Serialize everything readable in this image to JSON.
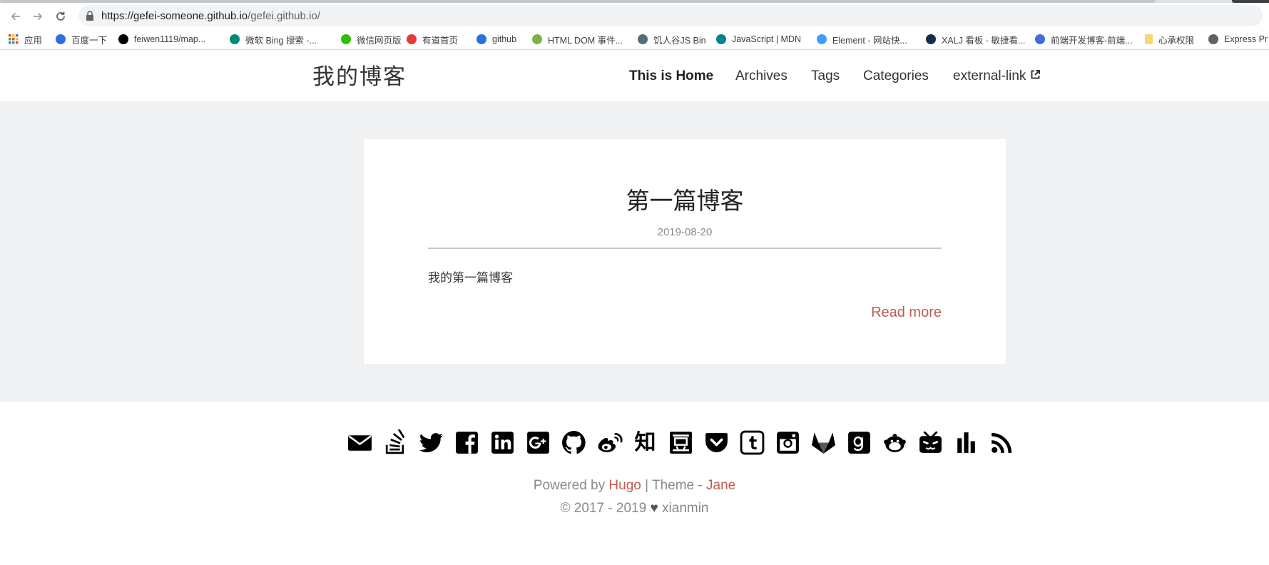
{
  "browser": {
    "url_host": "https://gefei-someone.github.io",
    "url_path": "/gefei.github.io/",
    "bookmarks": [
      {
        "label": "应用",
        "icon": "apps-grid-icon",
        "color": "#e8453c"
      },
      {
        "label": "百度一下",
        "icon": "baidu-paw-icon",
        "color": "#2d6fe0"
      },
      {
        "label": "feiwen1119/map...",
        "icon": "github-icon",
        "color": "#000000"
      },
      {
        "label": "微软 Bing 搜索 -...",
        "icon": "bing-icon",
        "color": "#00897b"
      },
      {
        "label": "微信网页版",
        "icon": "wechat-icon",
        "color": "#2dc100"
      },
      {
        "label": "有道首页",
        "icon": "youdao-icon",
        "color": "#e53935"
      },
      {
        "label": "github",
        "icon": "baidu-paw-icon",
        "color": "#2d6fe0"
      },
      {
        "label": "HTML DOM 事件...",
        "icon": "runoob-icon",
        "color": "#7cb342"
      },
      {
        "label": "饥人谷JS Bin",
        "icon": "jsbin-icon",
        "color": "#546e7a"
      },
      {
        "label": "JavaScript | MDN",
        "icon": "mdn-icon",
        "color": "#00838f"
      },
      {
        "label": "Element - 网站快...",
        "icon": "element-icon",
        "color": "#409eff"
      },
      {
        "label": "XALJ 看板 - 敏捷看...",
        "icon": "jira-icon",
        "color": "#172b4d"
      },
      {
        "label": "前端开发博客-前端...",
        "icon": "blog-icon",
        "color": "#3f6fd6"
      },
      {
        "label": "心承权限",
        "icon": "folder-icon",
        "color": "#f7d774"
      },
      {
        "label": "Express Pr",
        "icon": "globe-icon",
        "color": "#5f6368"
      }
    ]
  },
  "site": {
    "logo": "我的博客",
    "menu": [
      {
        "label": "This is Home"
      },
      {
        "label": "Archives"
      },
      {
        "label": "Tags"
      },
      {
        "label": "Categories"
      },
      {
        "label": "external-link"
      }
    ]
  },
  "post": {
    "title": "第一篇博客",
    "date": "2019-08-20",
    "summary": "我的第一篇博客",
    "read_more": "Read more"
  },
  "footer": {
    "social_icons": [
      "email-icon",
      "stackoverflow-icon",
      "twitter-icon",
      "facebook-icon",
      "linkedin-icon",
      "google-plus-icon",
      "github-icon",
      "weibo-icon",
      "zhihu-icon",
      "douban-icon",
      "pocket-icon",
      "tumblr-icon",
      "instagram-icon",
      "gitlab-icon",
      "goodreads-icon",
      "bilibili-mascot-icon",
      "bilibili-tv-icon",
      "chart-bars-icon",
      "rss-icon"
    ],
    "zhihu_glyph": "知",
    "powered_prefix": "Powered by ",
    "powered_hugo": "Hugo",
    "powered_sep": " | Theme - ",
    "powered_theme": "Jane",
    "copyright_prefix": "© 2017 - 2019 ",
    "copyright_heart": "♥",
    "copyright_author": " xianmin"
  },
  "colors": {
    "accent": "#c05b4d",
    "main_bg": "#f0f1f3",
    "muted_text": "#8a8a8a"
  }
}
